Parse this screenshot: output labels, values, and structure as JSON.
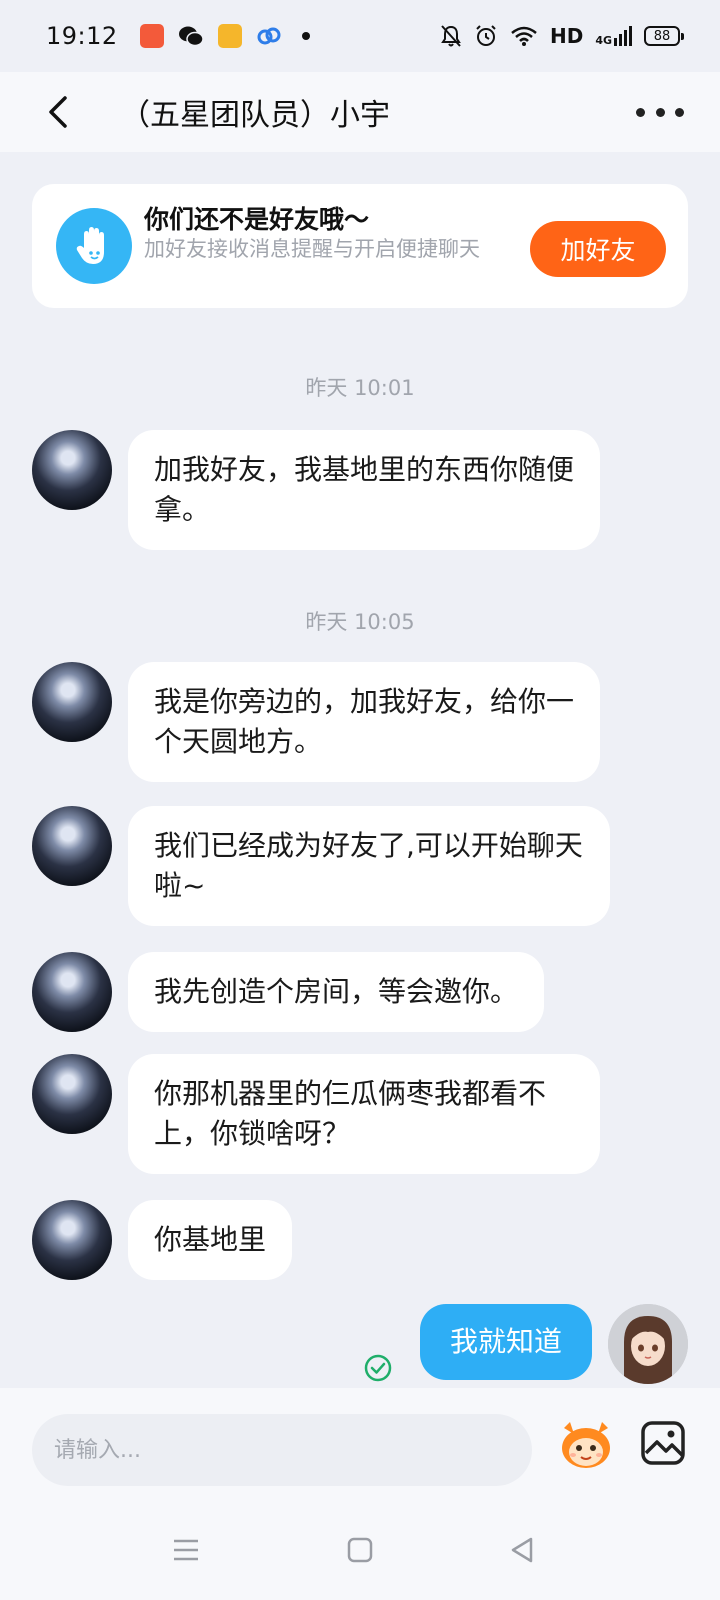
{
  "status_bar": {
    "time": "19:12",
    "network_label": "HD",
    "signal_label": "4G",
    "battery_level": "88"
  },
  "header": {
    "title": "（五星团队员）小宇"
  },
  "friend_card": {
    "title": "你们还不是好友哦～",
    "subtitle": "加好友接收消息提醒与开启便捷聊天",
    "button_label": "加好友"
  },
  "messages": [
    {
      "time": "昨天 10:01"
    },
    {
      "sender": "other",
      "text": "加我好友，我基地里的东西你随便拿。"
    },
    {
      "time": "昨天 10:05"
    },
    {
      "sender": "other",
      "text": "我是你旁边的，加我好友，给你一个天圆地方。"
    },
    {
      "sender": "other",
      "text": "我们已经成为好友了,可以开始聊天啦~"
    },
    {
      "sender": "other",
      "text": "我先创造个房间，等会邀你。"
    },
    {
      "sender": "other",
      "text": "你那机器里的仨瓜俩枣我都看不上，你锁啥呀？"
    },
    {
      "sender": "other",
      "text": "你基地里"
    },
    {
      "sender": "self",
      "text": "我就知道",
      "read": true
    }
  ],
  "input": {
    "placeholder": "请输入..."
  },
  "colors": {
    "accent_blue": "#2eaef5",
    "add_button": "#ff6416",
    "background": "#eef0f6",
    "read_check": "#1fae6a"
  },
  "icons": {
    "back": "chevron-left-icon",
    "more": "more-dots-icon",
    "hand": "hand-wave-icon",
    "emoji": "emoji-mascot-icon",
    "image": "image-icon"
  }
}
